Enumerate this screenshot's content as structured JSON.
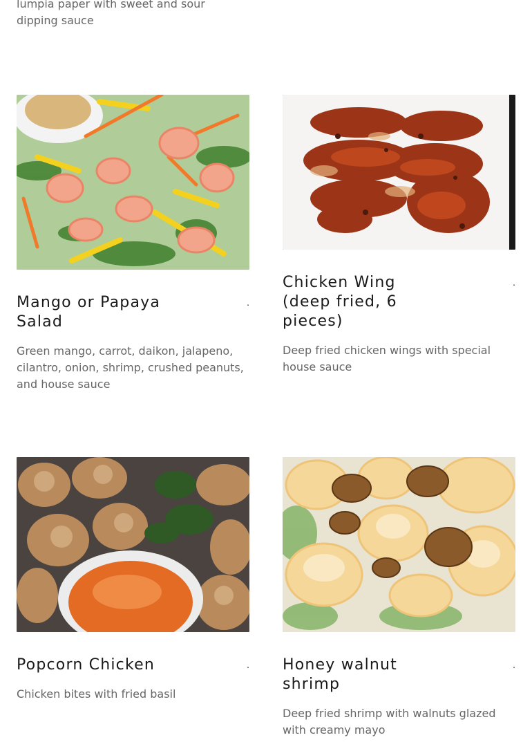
{
  "top": {
    "desc": "lumpia paper with sweet and sour dipping sauce"
  },
  "items": [
    {
      "title": "Mango or Papaya Salad",
      "price": ".",
      "desc": "Green mango, carrot, daikon, jalapeno, cilantro, onion, shrimp, crushed peanuts, and house sauce",
      "image": "mango-salad-photo"
    },
    {
      "title": "Chicken Wing (deep fried, 6 pieces)",
      "price": ".",
      "desc": "Deep fried chicken wings with special house sauce",
      "image": "chicken-wing-photo"
    },
    {
      "title": "Popcorn Chicken",
      "price": ".",
      "desc": "Chicken bites with fried basil",
      "image": "popcorn-chicken-photo"
    },
    {
      "title": "Honey walnut shrimp",
      "price": ".",
      "desc": "Deep fried shrimp with walnuts glazed with creamy mayo",
      "image": "honey-walnut-shrimp-photo"
    }
  ],
  "colors": {
    "text": "#1a1a1a",
    "muted": "#666666",
    "background": "#ffffff"
  }
}
